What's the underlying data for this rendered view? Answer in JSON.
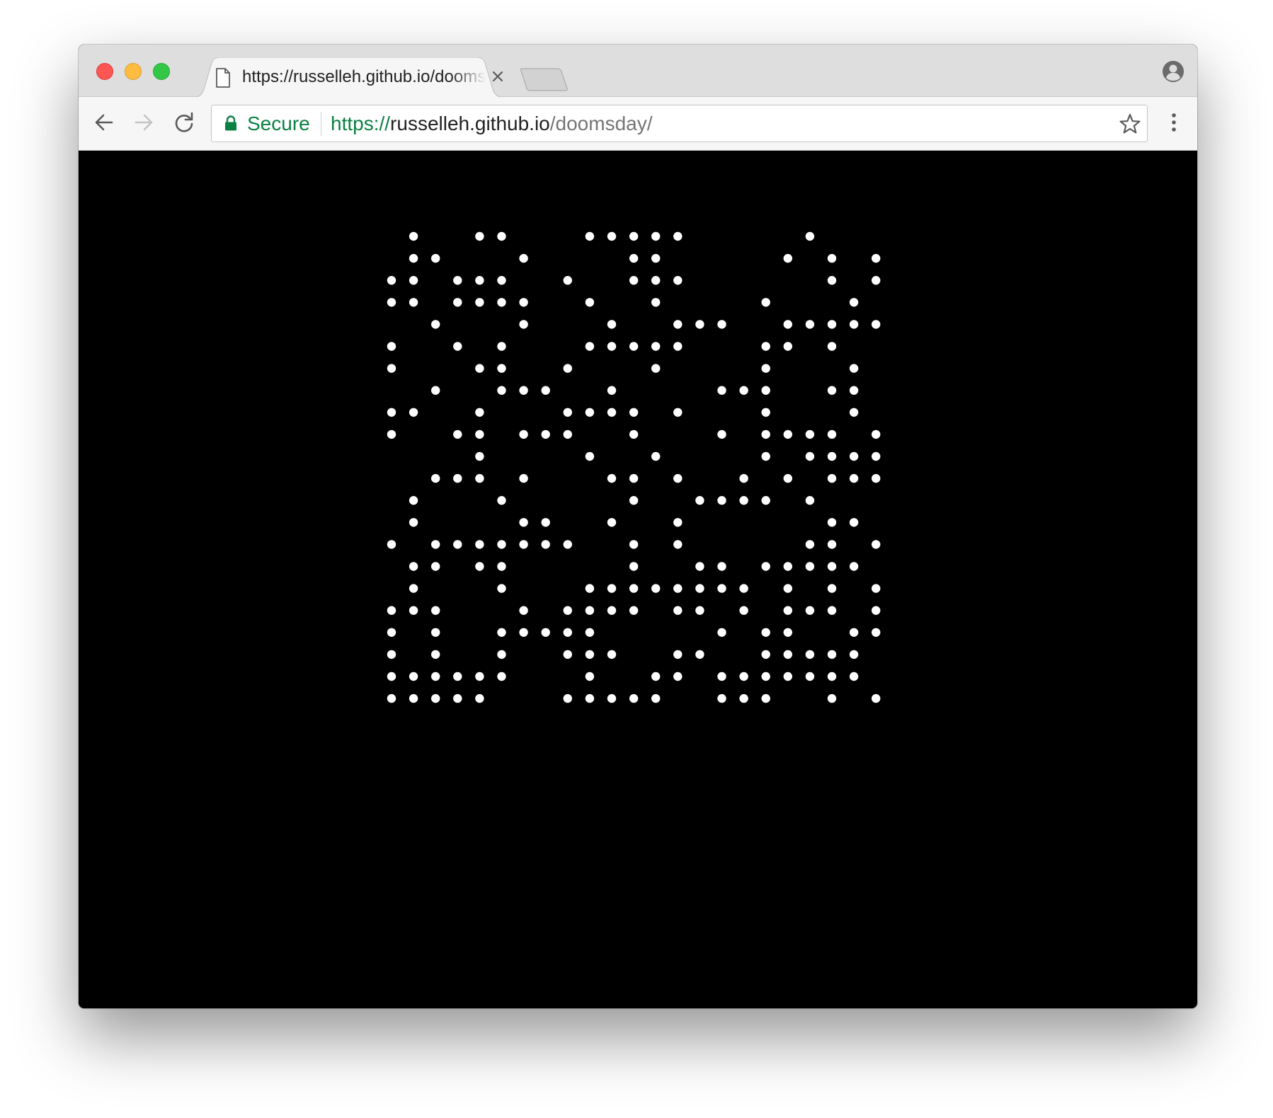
{
  "browser": {
    "tab": {
      "title": "https://russelleh.github.io/doomsday/",
      "favicon": "page-icon",
      "close_icon": "close-icon"
    },
    "new_tab_icon": "new-tab-icon",
    "profile_icon": "profile-icon",
    "toolbar": {
      "back_icon": "back-arrow-icon",
      "forward_icon": "forward-arrow-icon",
      "reload_icon": "reload-icon",
      "menu_icon": "kebab-menu-icon"
    },
    "omnibox": {
      "secure_label": "Secure",
      "url_scheme": "https://",
      "url_host": "russelleh.github.io",
      "url_path": "/doomsday/",
      "lock_icon": "lock-icon",
      "bookmark_icon": "star-icon",
      "secure_color": "#0b8043"
    }
  },
  "page": {
    "background_color": "#000000",
    "dot_color": "#ffffff",
    "grid": [
      "01001100011111000001000",
      "01100010000110000010101",
      "11011100100111000000101",
      "11011110010010000100010",
      "00100010001001110011111",
      "10010100011111000110100",
      "10001100100010000100010",
      "00100111001000011100110",
      "11001000111101000100010",
      "10011011100100010111101",
      "00001000010010000101111",
      "00111010001101001010111",
      "01000100000100111101000",
      "01000011001001000000110",
      "10111111100101000001101",
      "01101100000100110111110",
      "01000100011111111010101",
      "11100010111101101011101",
      "10100111110000010110011",
      "10100100111001100111110",
      "11111100010011011111110",
      "11111000111110011100101"
    ]
  }
}
